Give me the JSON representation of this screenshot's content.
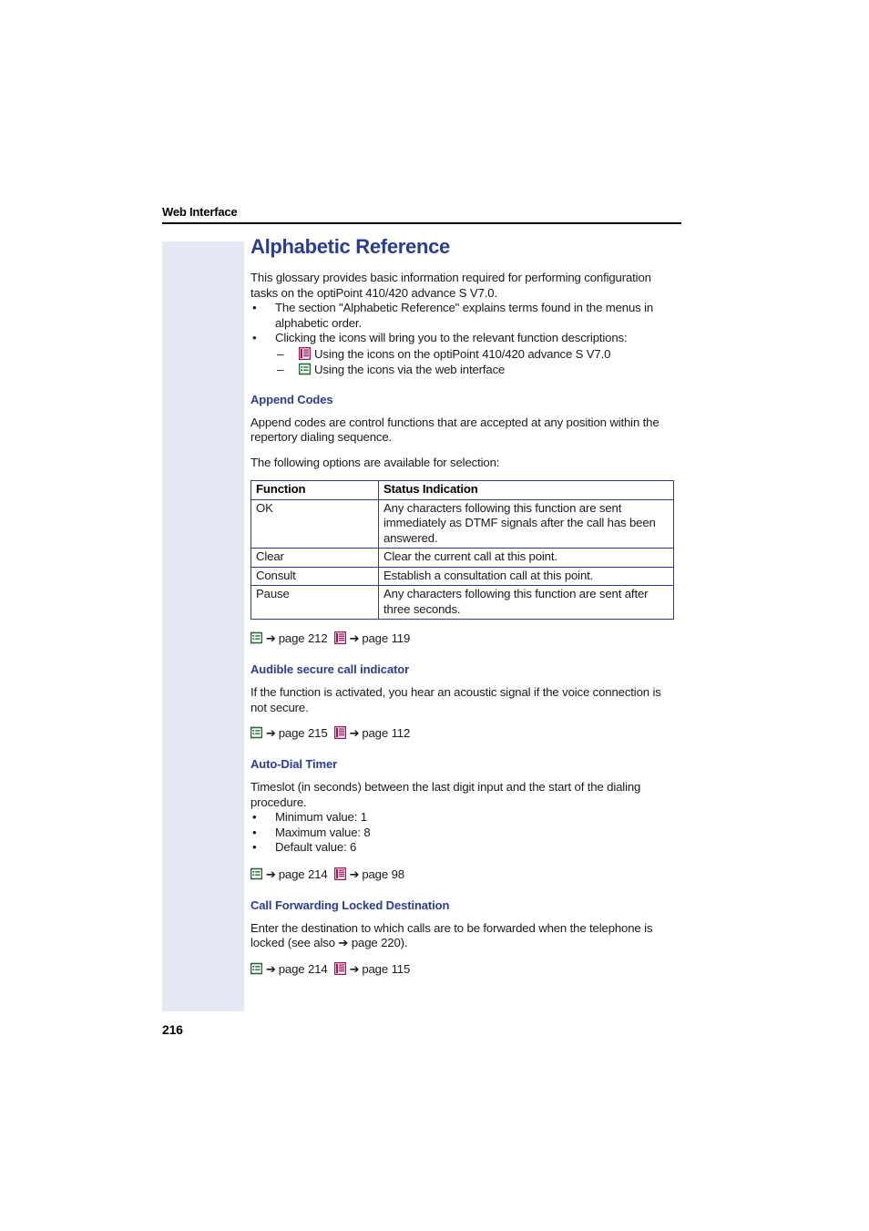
{
  "header": {
    "running_title": "Web Interface"
  },
  "folio": {
    "page_number": "216"
  },
  "colors": {
    "heading_blue": "#2b3d91",
    "margin_block": "#e4e8f4",
    "phone_icon": "#a4145a",
    "web_icon": "#1e6b32",
    "table_border": "#2b3d91"
  },
  "doc": {
    "title": "Alphabetic Reference",
    "intro": "This glossary provides basic information required for performing configuration tasks on the optiPoint 410/420 advance S V7.0.",
    "bullets": [
      {
        "text": "The section \"Alphabetic Reference\" explains terms found in the menus in alphabetic order."
      },
      {
        "text": "Clicking the icons will bring you to the relevant function descriptions:",
        "sub_items": [
          {
            "icon": "phone-display-icon",
            "text": "Using the icons on the optiPoint 410/420 advance S V7.0"
          },
          {
            "icon": "web-interface-icon",
            "text": "Using the icons via the web interface"
          }
        ]
      }
    ]
  },
  "sections": [
    {
      "id": "append-codes",
      "title": "Append Codes",
      "paragraphs": [
        "Append codes are control functions that are accepted at any position within the repertory dialing sequence.",
        "The following options are available for selection:"
      ],
      "table": {
        "columns": [
          "Function",
          "Status Indication"
        ],
        "rows": [
          [
            "OK",
            "Any characters following this function are sent immediately as DTMF signals after the call has been answered."
          ],
          [
            "Clear",
            "Clear the current call at this point."
          ],
          [
            "Consult",
            "Establish a consultation call at this point."
          ],
          [
            "Pause",
            "Any characters following this function are sent after three seconds."
          ]
        ]
      },
      "refs": {
        "web_label": "page 212",
        "phone_label": "page 119",
        "arrow": "➔"
      }
    },
    {
      "id": "audible-secure-call-indicator",
      "title": "Audible secure call indicator",
      "paragraphs": [
        "If the function is activated, you hear an acoustic signal if the voice connection is not secure."
      ],
      "refs": {
        "web_label": "page 215",
        "phone_label": "page 112",
        "arrow": "➔"
      }
    },
    {
      "id": "auto-dial-timer",
      "title": "Auto-Dial Timer",
      "paragraphs": [
        "Timeslot (in seconds) between the last digit input and the start of the dialing procedure."
      ],
      "bullets": [
        "Minimum value: 1",
        "Maximum value: 8",
        "Default value: 6"
      ],
      "refs": {
        "web_label": "page 214",
        "phone_label": "page 98",
        "arrow": "➔"
      }
    },
    {
      "id": "call-forwarding-locked-destination",
      "title": "Call Forwarding Locked Destination",
      "paragraphs": [
        "Enter the destination to which calls are to be forwarded when the telephone is locked (see also ➔ page 220)."
      ],
      "refs": {
        "web_label": "page 214",
        "phone_label": "page 115",
        "arrow": "➔"
      }
    }
  ]
}
